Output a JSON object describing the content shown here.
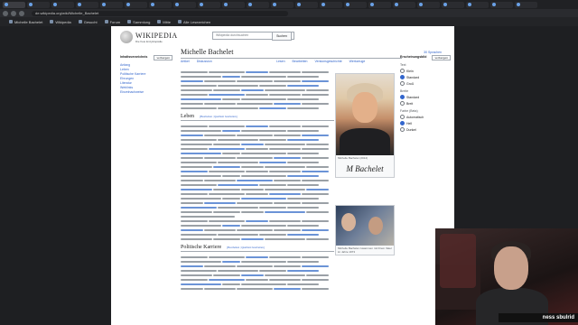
{
  "browser": {
    "tabs": [
      "",
      "",
      "",
      "",
      "",
      "",
      "",
      "",
      "",
      "",
      "",
      "",
      "",
      "",
      "",
      "",
      "",
      "",
      "",
      "",
      "",
      ""
    ],
    "url": "de.wikipedia.org/wiki/Michelle_Bachelet",
    "bookmarks": [
      "Michelle Bachelet",
      "Wikipedia",
      "Gesucht",
      "Forum",
      "Sammlung",
      "Mitte",
      "Alle Lesezeichen"
    ]
  },
  "wiki": {
    "logo_title": "WIKIPEDIA",
    "logo_sub": "Die freie Enzyklopädie",
    "search_placeholder": "Wikipedia durchsuchen",
    "search_button": "Suchen",
    "user_tools": "30 Sprachen",
    "title": "Michelle Bachelet",
    "tab_article": "Artikel",
    "tab_discussion": "Diskussion",
    "tab_read": "Lesen",
    "tab_edit": "Bearbeiten",
    "tab_history": "Versionsgeschichte",
    "tab_tools": "Werkzeuge",
    "sidebar_title": "Inhaltsverzeichnis",
    "sidebar_hide": "verbergen",
    "sidebar_items": [
      "Anfang",
      "Leben",
      "Politische Karriere",
      "Ehrungen",
      "Literatur",
      "Weblinks",
      "Einzelnachweise"
    ],
    "section_leben": "Leben",
    "section_karriere": "Politische Karriere",
    "edit_link": "[Bearbeiten | Quelltext bearbeiten]",
    "infobox_caption1": "Michelle Bachelet (2014)",
    "infobox_signature": "M Bachelet",
    "infobox_caption2": "Michelle Bachelet zusammen mit ihrem Vater im Jahre 1973",
    "right_title": "Erscheinungsbild",
    "right_hide": "verbergen",
    "right_text_label": "Text",
    "right_text_opts": [
      "Klein",
      "Standard",
      "Groß"
    ],
    "right_width_label": "Breite",
    "right_width_opts": [
      "Standard",
      "Breit"
    ],
    "right_color_label": "Farbe (Beta)",
    "right_color_opts": [
      "Automatisch",
      "Hell",
      "Dunkel"
    ]
  },
  "stream": {
    "name": "ness  sbulrid"
  }
}
